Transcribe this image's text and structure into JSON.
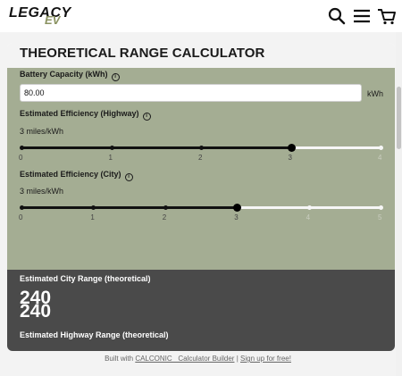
{
  "header": {
    "logo_main": "LEGACY",
    "logo_sub": "EV",
    "icons": [
      "search-icon",
      "menu-icon",
      "cart-icon"
    ]
  },
  "calculator": {
    "title": "THEORETICAL RANGE CALCULATOR",
    "battery": {
      "label": "Battery Capacity (kWh)",
      "value": "80.00",
      "unit": "kWh"
    },
    "highway": {
      "label": "Estimated Efficiency (Highway)",
      "value_text": "3 miles/kWh",
      "value": 3,
      "ticks": [
        "0",
        "1",
        "2",
        "3",
        "4"
      ]
    },
    "city": {
      "label": "Estimated Efficiency (City)",
      "value_text": "3 miles/kWh",
      "value": 3,
      "ticks": [
        "0",
        "1",
        "2",
        "3",
        "4",
        "5"
      ]
    }
  },
  "results": {
    "city_label": "Estimated City Range (theoretical)",
    "city_value": "240",
    "highway_label": "Estimated Highway Range (theoretical)",
    "highway_value": "240"
  },
  "footer": {
    "prefix": "Built with",
    "builder_link": "CALCONIC_ Calculator Builder",
    "separator": "|",
    "signup_link": "Sign up for free!"
  },
  "colors": {
    "inputs_panel": "#a4ad93",
    "results_panel": "#4a4a4a",
    "logo_accent": "#8a9260"
  }
}
